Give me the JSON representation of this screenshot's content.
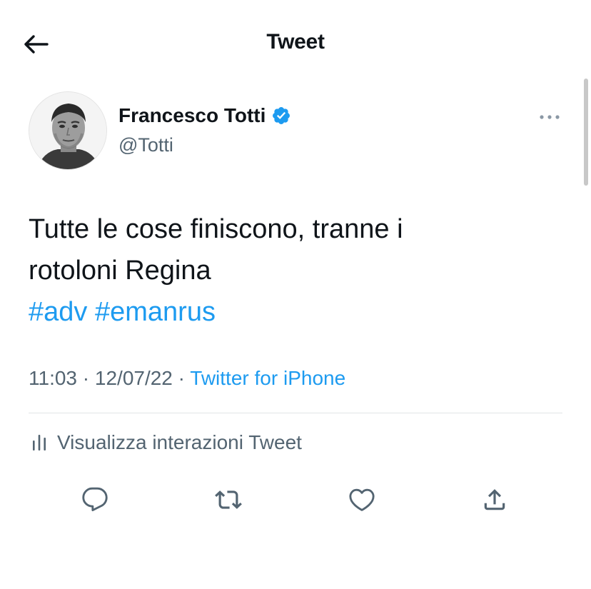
{
  "header": {
    "title": "Tweet",
    "back_icon": "arrow-left-icon"
  },
  "author": {
    "name": "Francesco Totti",
    "handle": "@Totti",
    "verified_icon": "verified-badge-icon",
    "verified_color": "#1d9bf0"
  },
  "more_icon": "more-horizontal-icon",
  "tweet": {
    "lines": [
      "Tutte le cose finiscono, tranne i",
      "rotoloni Regina"
    ],
    "hashtags": [
      "#adv",
      "#emanrus"
    ]
  },
  "meta": {
    "time": "11:03",
    "separator": " · ",
    "date": "12/07/22",
    "source": "Twitter for iPhone"
  },
  "analytics": {
    "label": "Visualizza interazioni Tweet",
    "icon": "analytics-icon"
  },
  "actions": [
    {
      "icon": "reply-icon"
    },
    {
      "icon": "retweet-icon"
    },
    {
      "icon": "like-icon"
    },
    {
      "icon": "share-icon"
    }
  ],
  "colors": {
    "text": "#0f1419",
    "secondary": "#536471",
    "link": "#1d9bf0",
    "divider": "#e1e4e6"
  }
}
